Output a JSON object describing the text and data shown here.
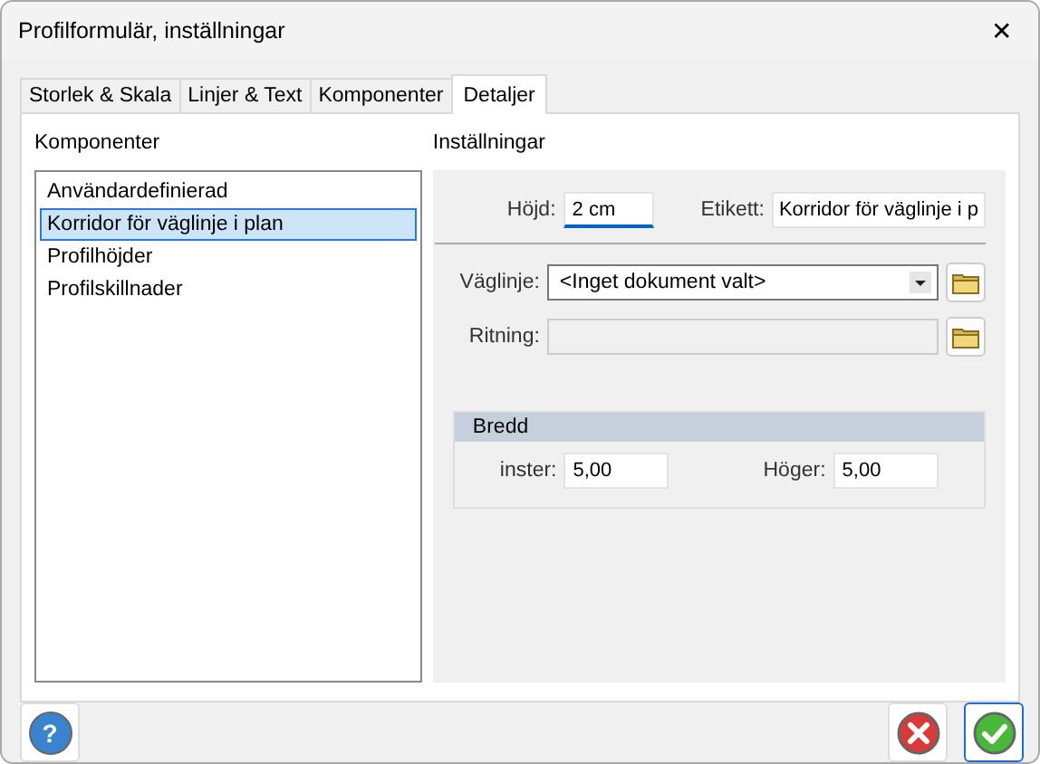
{
  "window": {
    "title": "Profilformulär, inställningar",
    "close_glyph": "✕"
  },
  "tabs": [
    {
      "label": "Storlek & Skala",
      "selected": false
    },
    {
      "label": "Linjer & Text",
      "selected": false
    },
    {
      "label": "Komponenter",
      "selected": false
    },
    {
      "label": "Detaljer",
      "selected": true
    }
  ],
  "components": {
    "heading": "Komponenter",
    "items": [
      {
        "label": "Användardefinierad",
        "selected": false
      },
      {
        "label": "Korridor för väglinje i plan",
        "selected": true
      },
      {
        "label": "Profilhöjder",
        "selected": false
      },
      {
        "label": "Profilskillnader",
        "selected": false
      }
    ]
  },
  "settings": {
    "heading": "Inställningar",
    "height": {
      "label": "Höjd:",
      "value": "2 cm"
    },
    "tag": {
      "label": "Etikett:",
      "value": "Korridor för väglinje i p"
    },
    "road_line": {
      "label": "Väglinje:",
      "value": "<Inget dokument valt>"
    },
    "drawing": {
      "label": "Ritning:"
    },
    "width": {
      "title": "Bredd",
      "left": {
        "label": "inster:",
        "value": "5,00"
      },
      "right": {
        "label": "Höger:",
        "value": "5,00"
      }
    }
  },
  "buttons": {
    "help": "?"
  }
}
